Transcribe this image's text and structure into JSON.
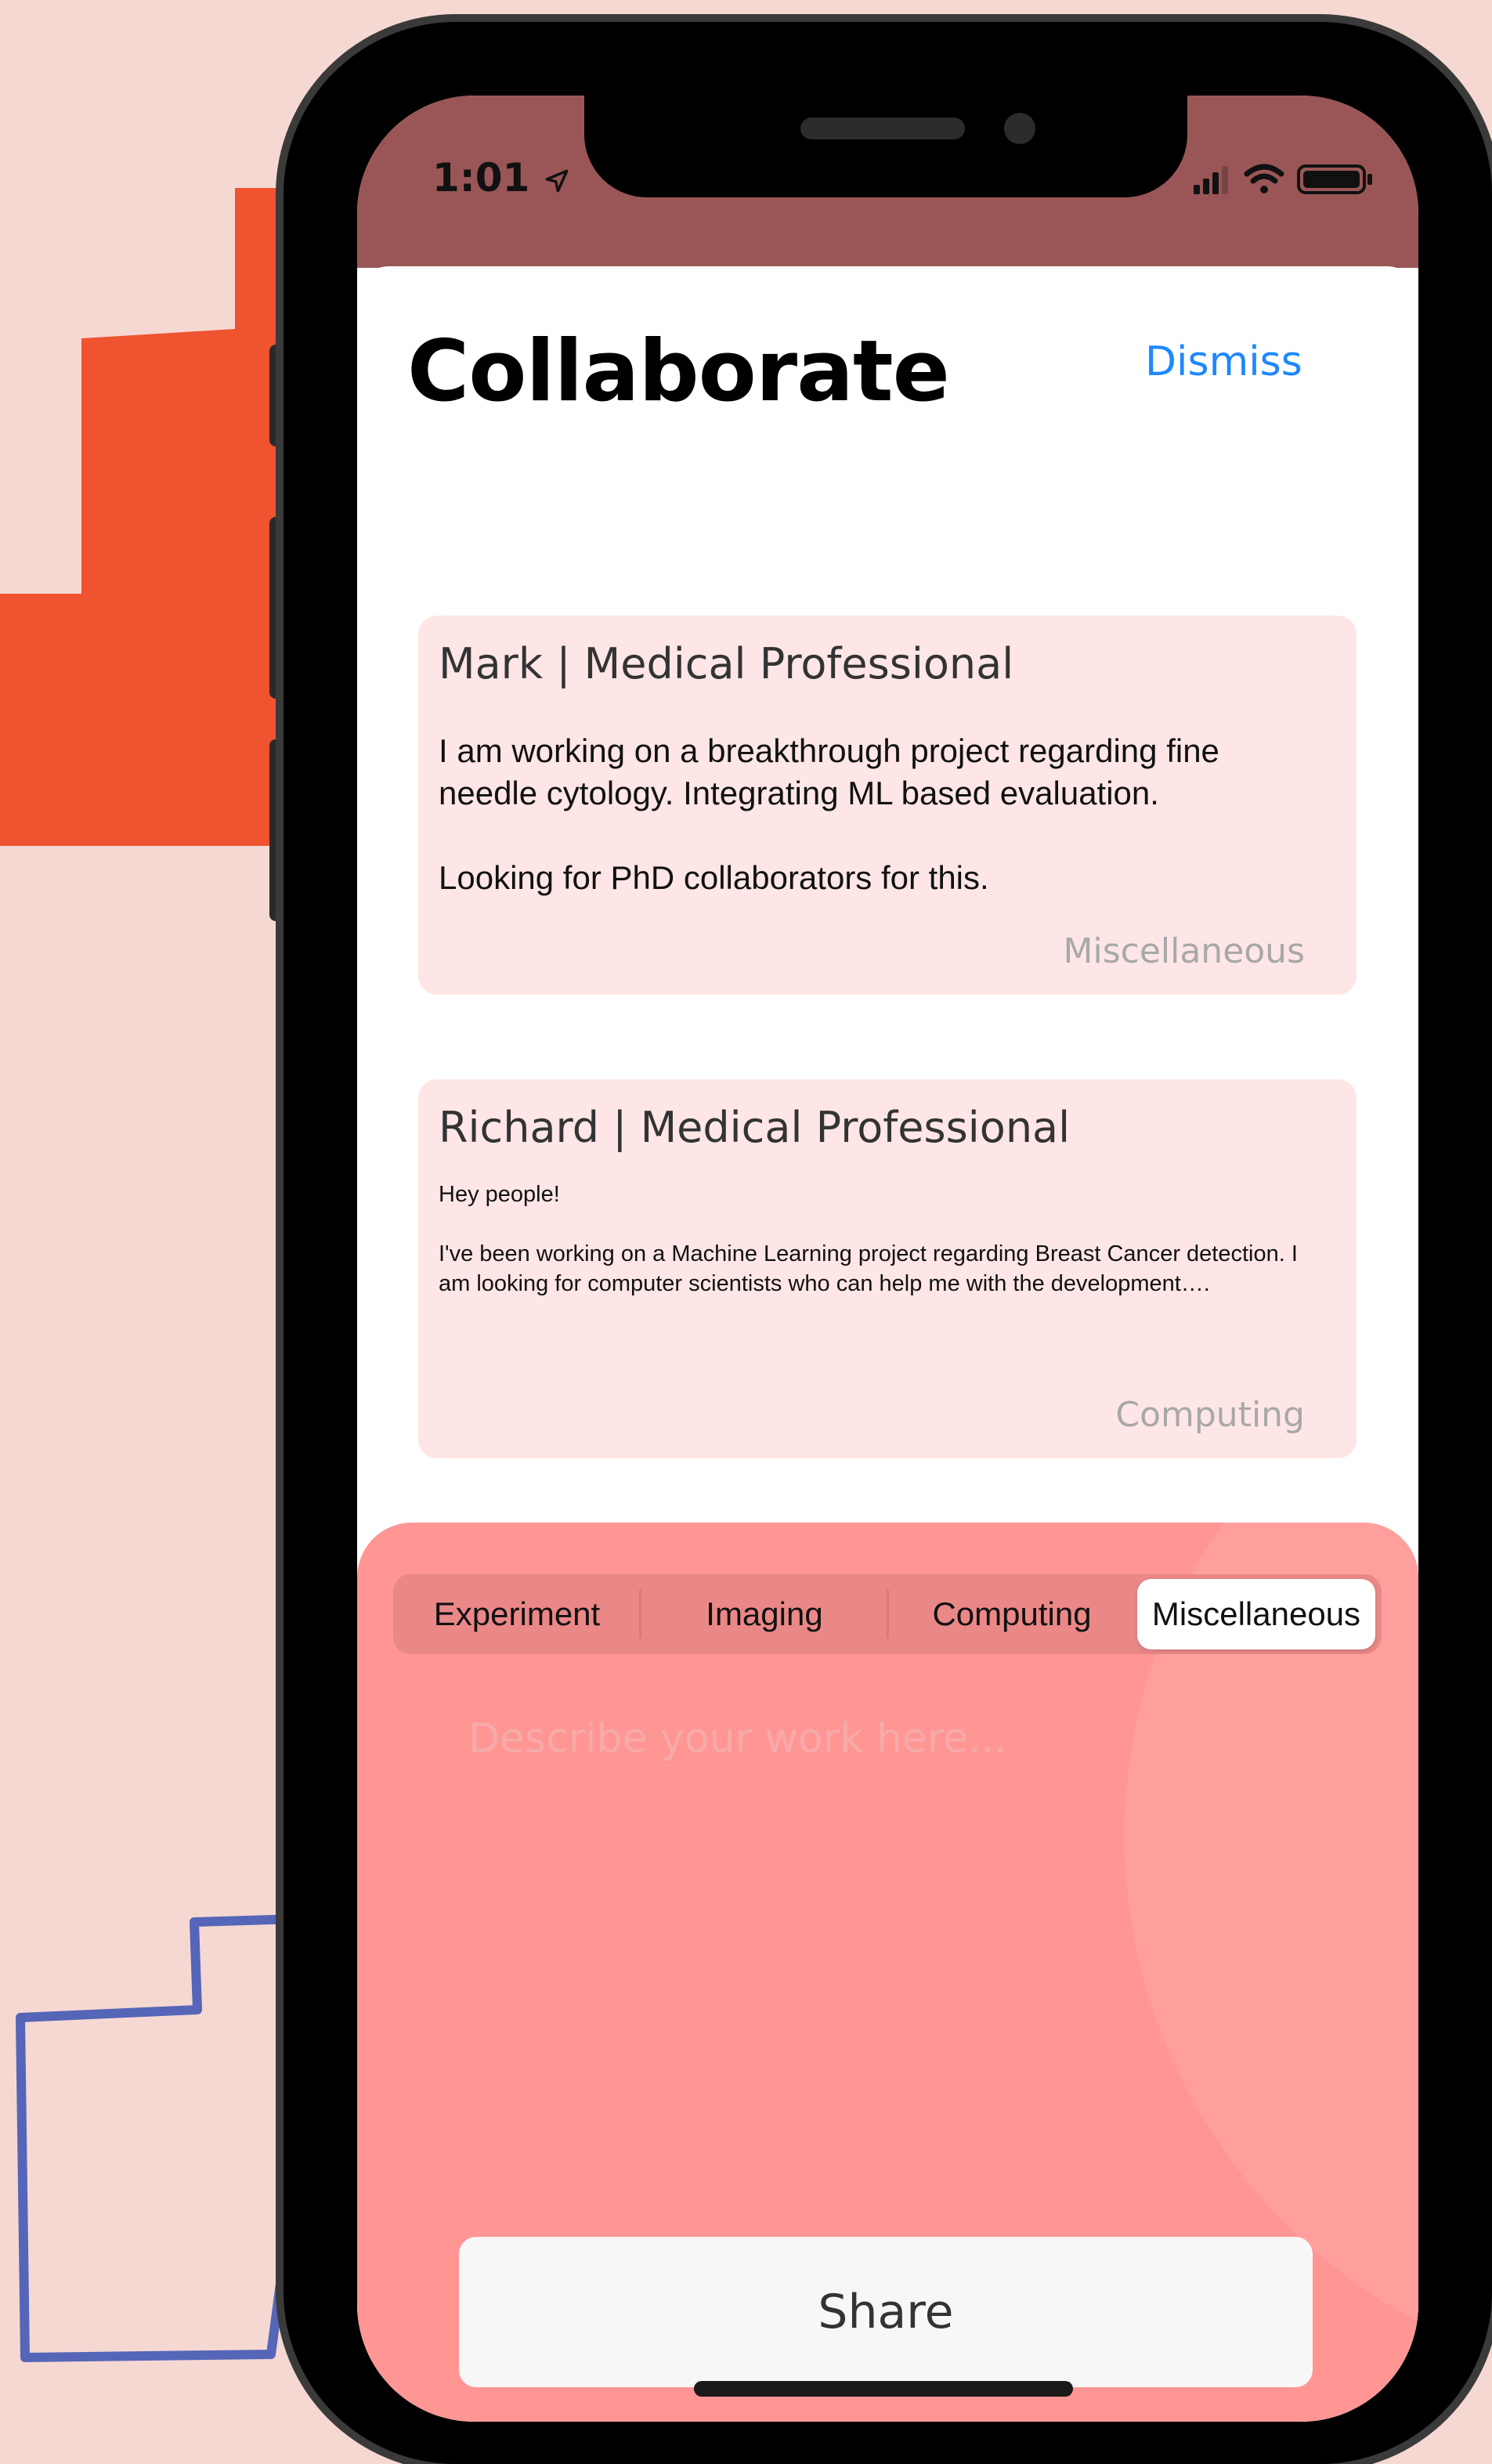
{
  "status_bar": {
    "time": "1:01"
  },
  "header": {
    "title": "Collaborate",
    "dismiss_label": "Dismiss"
  },
  "posts": [
    {
      "author": "Mark | Medical Professional",
      "body": "I am working on a breakthrough project regarding fine needle cytology. Integrating ML based evaluation.\n\nLooking for PhD collaborators for this.",
      "category": "Miscellaneous"
    },
    {
      "author": "Richard | Medical Professional",
      "body": "Hey people!\n\nI've been working on a Machine Learning project regarding Breast Cancer detection. I am looking for computer scientists who can help me with the development….",
      "category": "Computing"
    }
  ],
  "composer": {
    "categories": [
      "Experiment",
      "Imaging",
      "Computing",
      "Miscellaneous"
    ],
    "selected_category": "Miscellaneous",
    "placeholder": "Describe your work here...",
    "value": "",
    "share_label": "Share"
  },
  "colors": {
    "background": "#f6d8d3",
    "accent_orange": "#ef5330",
    "accent_blue_outline": "#5566b8",
    "status_bar": "#9a5656",
    "card_bg": "#ffe6e6",
    "composer_bg": "#ff9694",
    "link": "#1e88ff"
  },
  "icons": [
    "location-arrow-icon",
    "cellular-signal-icon",
    "wifi-icon",
    "battery-icon"
  ]
}
